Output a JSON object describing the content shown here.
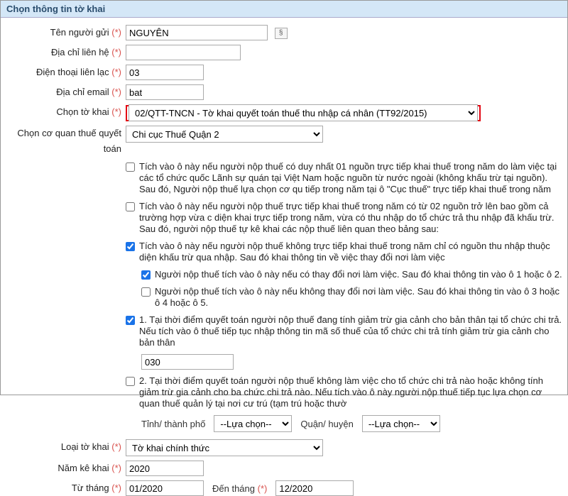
{
  "header": {
    "title": "Chọn thông tin tờ khai"
  },
  "labels": {
    "ten_nguoi_gui": "Tên người gửi",
    "dia_chi_lien_he": "Địa chỉ liên hệ",
    "dien_thoai_lien_lac": "Điện thoại liên lạc",
    "dia_chi_email": "Địa chỉ email",
    "chon_to_khai": "Chọn tờ khai",
    "chon_co_quan_thue": "Chọn cơ quan thuế quyết toán",
    "loai_to_khai": "Loại tờ khai",
    "nam_ke_khai": "Năm kê khai",
    "tu_thang": "Từ tháng",
    "den_thang": "Đến tháng",
    "tinh_tp": "Tỉnh/ thành phố",
    "quan_huyen": "Quận/ huyện",
    "req": "(*)"
  },
  "fields": {
    "ten_nguoi_gui": "NGUYÊN",
    "dia_chi_lien_he": "",
    "dien_thoai_lien_lac": "03",
    "dia_chi_email": "bat",
    "to_khai": "02/QTT-TNCN - Tờ khai quyết toán thuế thu nhập cá nhân (TT92/2015)",
    "co_quan_thue": "Chi cục Thuế Quận 2",
    "loai_to_khai": "Tờ khai chính thức",
    "nam_ke_khai": "2020",
    "tu_thang": "01/2020",
    "den_thang": "12/2020",
    "tinh_tp": "--Lựa chọn--",
    "quan_huyen": "--Lựa chọn--",
    "tax_code": "030"
  },
  "checkboxes": {
    "cb1": {
      "checked": false,
      "text": "Tích vào ô này nếu người nộp thuế có duy nhất 01 nguồn trực tiếp khai thuế trong năm do làm việc tại các tổ chức quốc Lãnh sự quán tại Việt Nam hoặc nguồn từ nước ngoài (không khấu trừ tại nguồn). Sau đó, Người nộp thuế lựa chọn cơ qu tiếp trong năm tại ô \"Cục thuế\" trực tiếp khai thuế trong năm"
    },
    "cb2": {
      "checked": false,
      "text": "Tích vào ô này nếu người nộp thuế trực tiếp khai thuế trong năm có từ 02 nguồn trở lên bao gồm cả trường hợp vừa c diện khai trực tiếp trong năm, vừa có thu nhập do tổ chức trả thu nhập đã khấu trừ. Sau đó, người nộp thuế tự kê khai các nộp thuế liên quan theo bảng sau:"
    },
    "cb3": {
      "checked": true,
      "text": "Tích vào ô này nếu người nộp thuế không trực tiếp khai thuế trong năm chỉ có nguồn thu nhập thuộc diện khấu trừ qua nhập. Sau đó khai thông tin về việc thay đổi nơi làm việc"
    },
    "cb3a": {
      "checked": true,
      "text": "Người nộp thuế tích vào ô này nếu có thay đổi nơi làm việc. Sau đó khai thông tin vào ô 1 hoặc ô 2."
    },
    "cb3b": {
      "checked": false,
      "text": "Người nộp thuế tích vào ô này nếu không thay đổi nơi làm việc. Sau đó khai thông tin vào ô 3 hoặc ô 4 hoặc ô 5."
    },
    "cb4": {
      "checked": true,
      "text": "1. Tại thời điểm quyết toán người nộp thuế đang tính giảm trừ gia cảnh cho bản thân tại tổ chức chi trả. Nếu tích vào ô thuế tiếp tục nhập thông tin mã số thuế của tổ chức chi trả tính giảm trừ gia cảnh cho bản thân"
    },
    "cb5": {
      "checked": false,
      "text": "2. Tại thời điểm quyết toán người nộp thuế không làm việc cho tổ chức chi trả nào hoặc không tính giảm trừ gia cảnh cho ba chức chi trả nào. Nếu tích vào ô này người nộp thuế tiếp tục lựa chọn cơ quan thuế quản lý tại nơi cư trú (tạm trú hoặc thườ"
    }
  }
}
